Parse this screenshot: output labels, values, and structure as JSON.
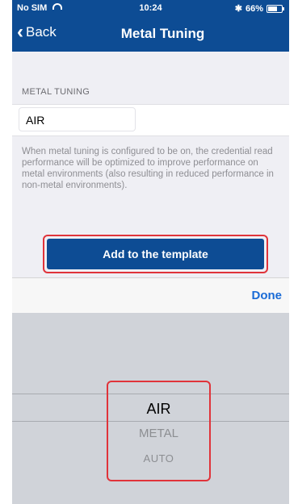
{
  "status_bar": {
    "carrier": "No SIM",
    "time": "10:24",
    "bluetooth": "✱",
    "battery_percent": "66%",
    "battery_level": 0.66
  },
  "nav": {
    "back_label": "Back",
    "title": "Metal Tuning"
  },
  "section": {
    "header": "METAL TUNING",
    "value": "AIR",
    "description": "When metal tuning is configured to be on, the credential read performance will be optimized to improve performance on metal environments (also resulting in reduced performance in non-metal environments)."
  },
  "add_button_label": "Add to the template",
  "toolbar": {
    "done_label": "Done"
  },
  "picker": {
    "options": [
      "AIR",
      "METAL",
      "AUTO"
    ],
    "selected": "AIR"
  },
  "colors": {
    "nav_bg": "#0d4c94",
    "highlight": "#e0333a",
    "link": "#1a6bd6"
  }
}
